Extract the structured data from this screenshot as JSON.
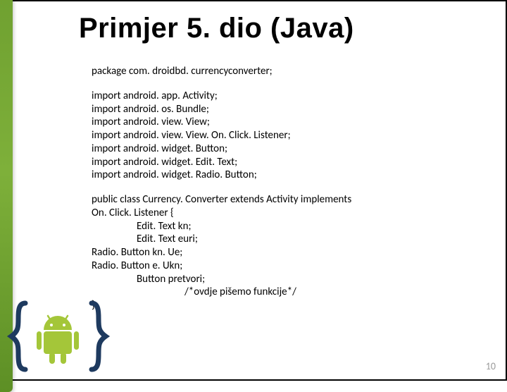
{
  "slide": {
    "title": "Primjer 5. dio (Java)"
  },
  "code": {
    "package": "package com. droidbd. currencyconverter;",
    "imports": [
      "import android. app. Activity;",
      "import android. os. Bundle;",
      "import android. view. View;",
      "import android. view. View. On. Click. Listener;",
      "import android. widget. Button;",
      "import android. widget. Edit. Text;",
      "import android. widget. Radio. Button;"
    ],
    "class_decl_1": "public class Currency. Converter extends Activity implements",
    "class_decl_2": "On. Click. Listener {",
    "body": [
      {
        "indent": 1,
        "text": "Edit. Text kn;"
      },
      {
        "indent": 1,
        "text": "Edit. Text euri;"
      },
      {
        "indent": 0,
        "text": "Radio. Button kn. Ue;"
      },
      {
        "indent": 0,
        "text": "Radio. Button e. Ukn;"
      },
      {
        "indent": 1,
        "text": "Button pretvori;"
      },
      {
        "indent": 2,
        "text": "/*ovdje pišemo funkcije*/"
      }
    ],
    "close": "}"
  },
  "page": {
    "number": "10"
  },
  "colors": {
    "green_bar": "#6fa030",
    "android_green": "#a4c639",
    "brace": "#1e3a5f"
  }
}
